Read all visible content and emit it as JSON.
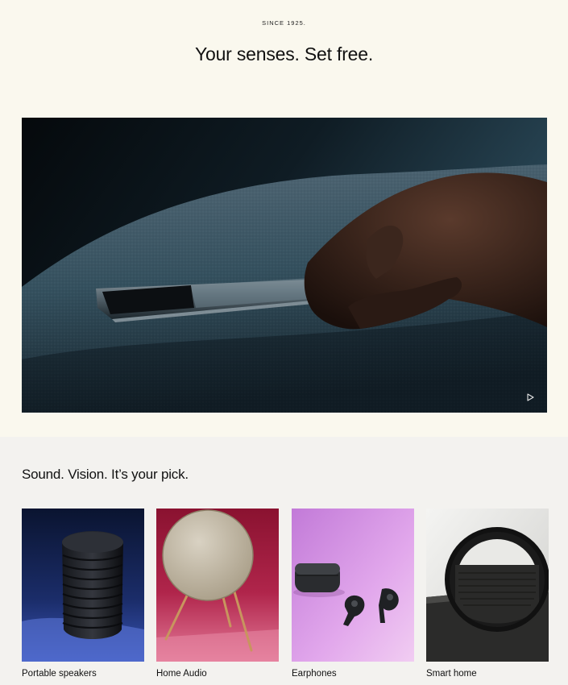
{
  "hero": {
    "eyebrow": "SINCE 1925.",
    "title": "Your senses. Set free.",
    "play_icon": "play-icon"
  },
  "categories": {
    "title": "Sound. Vision. It’s your pick.",
    "items": [
      {
        "label": "Portable speakers"
      },
      {
        "label": "Home Audio"
      },
      {
        "label": "Earphones"
      },
      {
        "label": "Smart home"
      }
    ]
  },
  "colors": {
    "hero_background": "#faf8ee",
    "section_background": "#f3f2ef",
    "text": "#111111"
  }
}
